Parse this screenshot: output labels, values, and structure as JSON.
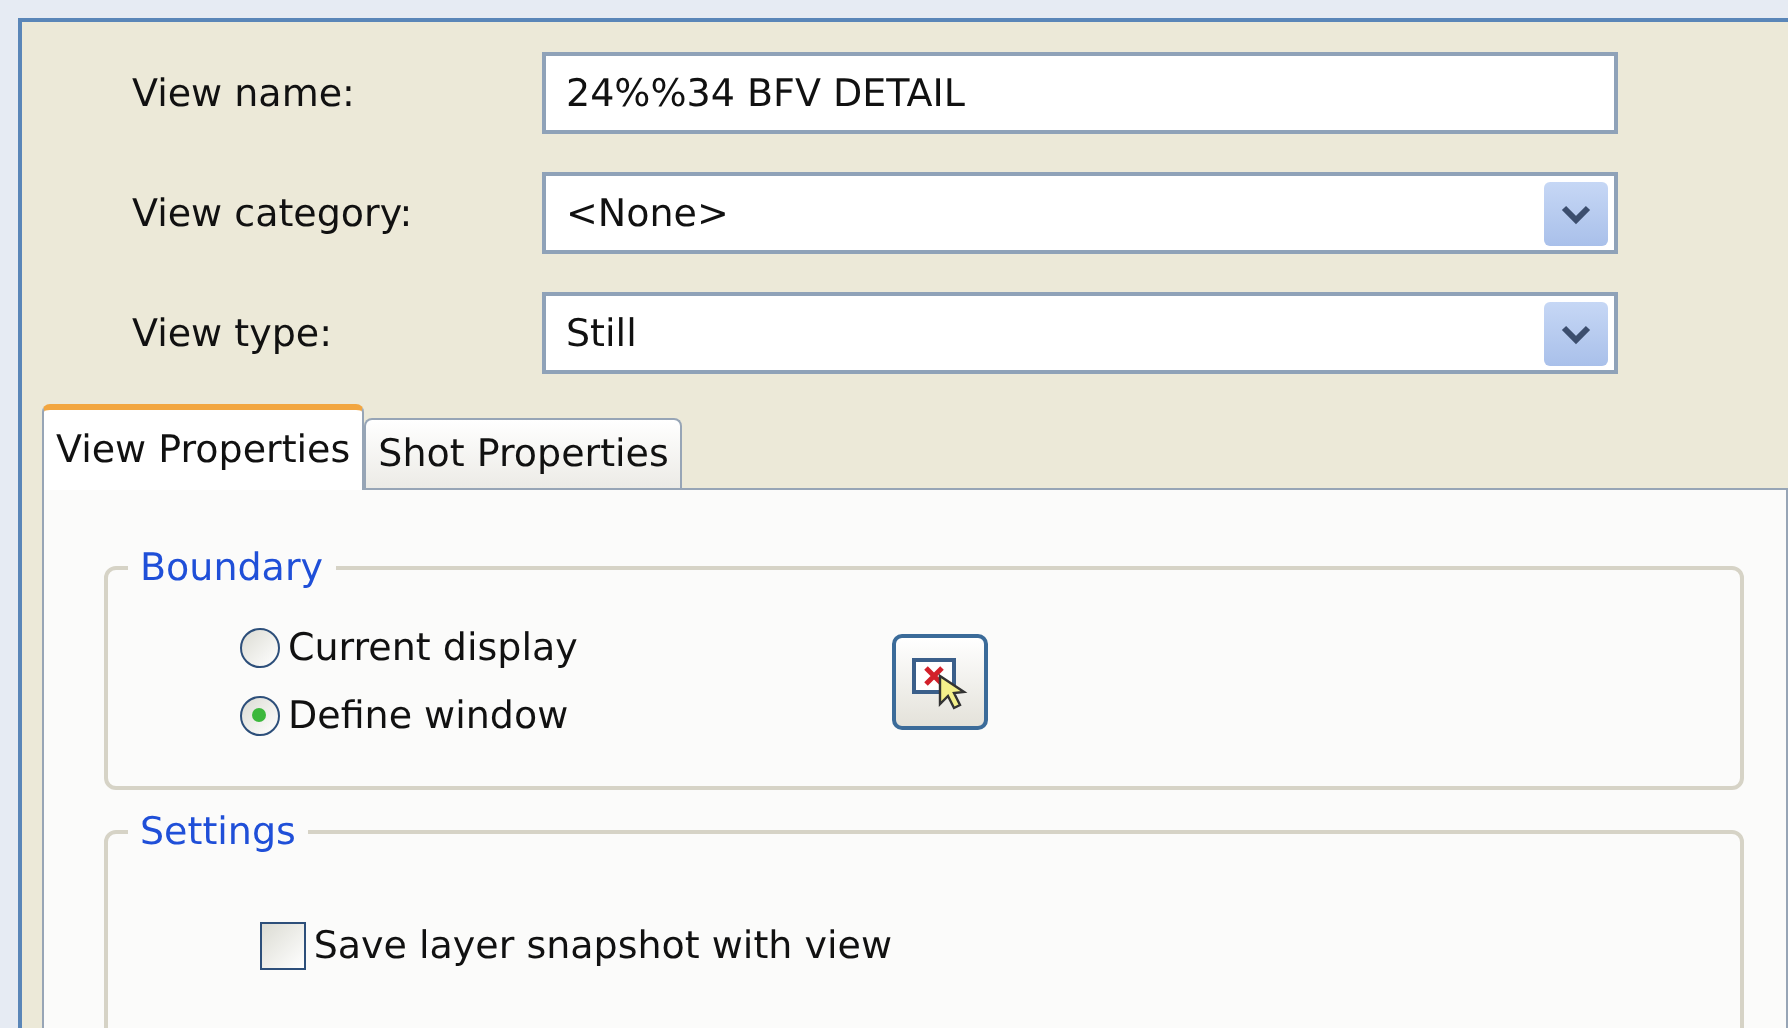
{
  "fields": [
    {
      "kind": "text",
      "label": "View name:",
      "value": "24%%34 BFV DETAIL"
    },
    {
      "kind": "dropdown",
      "label": "View category:",
      "value": "<None>"
    },
    {
      "kind": "dropdown",
      "label": "View type:",
      "value": "Still"
    }
  ],
  "tabs": [
    {
      "label": "View Properties",
      "selected": true
    },
    {
      "label": "Shot Properties",
      "selected": false
    }
  ],
  "groups": [
    {
      "title": "Boundary",
      "pick_button": true,
      "items": [
        {
          "kind": "radio",
          "label": "Current display",
          "selected": false
        },
        {
          "kind": "radio",
          "label": "Define window",
          "selected": true
        }
      ]
    },
    {
      "title": "Settings",
      "pick_button": false,
      "items": [
        {
          "kind": "checkbox",
          "label": "Save layer snapshot with view",
          "checked": false
        }
      ]
    }
  ]
}
